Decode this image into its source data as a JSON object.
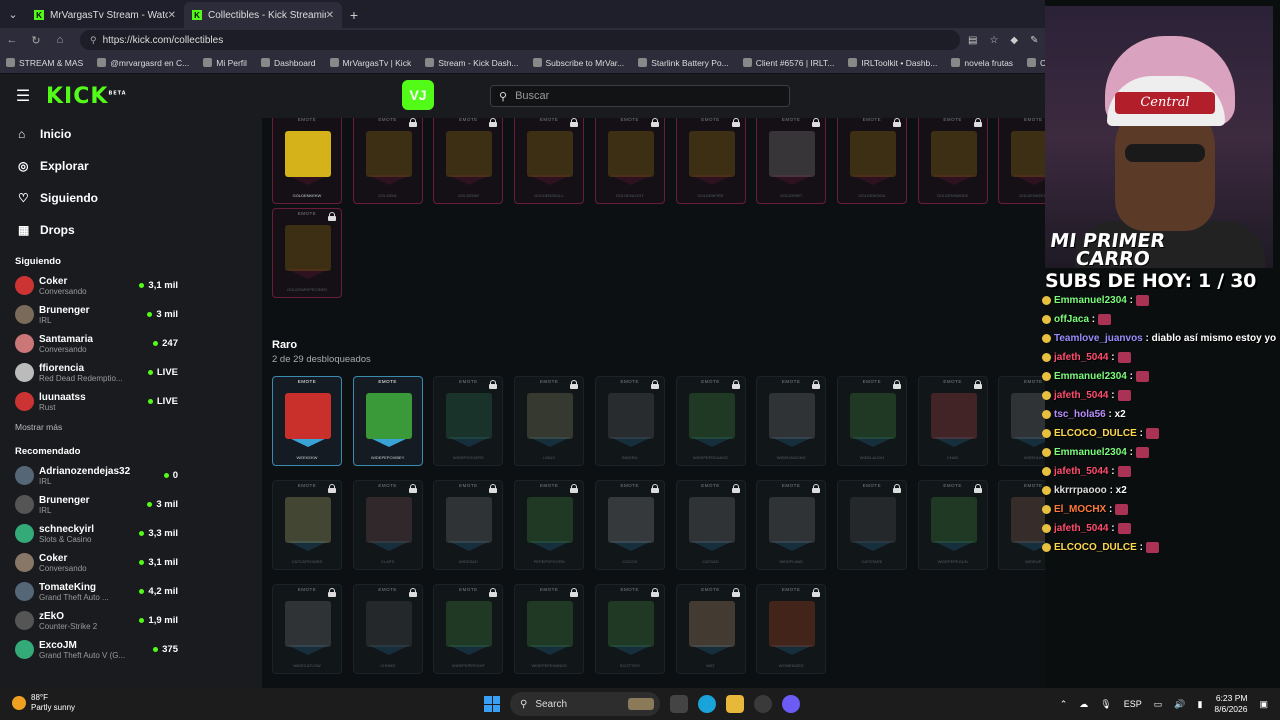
{
  "browser": {
    "tabs": [
      {
        "title": "MrVargasTv Stream - Watch Live o",
        "active": false
      },
      {
        "title": "Collectibles - Kick Streaming",
        "active": true
      }
    ],
    "url": "https://kick.com/collectibles",
    "bookmarks": [
      "STREAM & MAS",
      "@mrvargasrd en C...",
      "Mi Perfil",
      "Dashboard",
      "MrVargasTv | Kick",
      "Stream - Kick Dash...",
      "Subscribe to MrVar...",
      "Starlink Battery Po...",
      "Client #6576 | IRLT...",
      "IRLToolkit • Dashb...",
      "novela frutas",
      "Cu"
    ]
  },
  "header": {
    "logo": "KICK",
    "logo_sup": "BETA",
    "avatar_initials": "VJ",
    "search_placeholder": "Buscar"
  },
  "sidebar": {
    "nav": [
      {
        "label": "Inicio",
        "icon": "home-icon"
      },
      {
        "label": "Explorar",
        "icon": "compass-icon"
      },
      {
        "label": "Siguiendo",
        "icon": "heart-icon"
      },
      {
        "label": "Drops",
        "icon": "drops-icon"
      }
    ],
    "following_title": "Siguiendo",
    "following": [
      {
        "name": "Coker",
        "category": "Conversando",
        "viewers": "3,1 mil"
      },
      {
        "name": "Brunenger",
        "category": "IRL",
        "viewers": "3 mil"
      },
      {
        "name": "Santamaria",
        "category": "Conversando",
        "viewers": "247"
      },
      {
        "name": "ffiorencia",
        "category": "Red Dead Redemptio...",
        "viewers": "LIVE"
      },
      {
        "name": "luunaatss",
        "category": "Rust",
        "viewers": "LIVE"
      }
    ],
    "show_more": "Mostrar más",
    "recommended_title": "Recomendado",
    "recommended": [
      {
        "name": "Adrianozendejas32",
        "category": "IRL",
        "viewers": "0"
      },
      {
        "name": "Brunenger",
        "category": "IRL",
        "viewers": "3 mil"
      },
      {
        "name": "schneckyirl",
        "category": "Slots & Casino",
        "viewers": "3,3 mil"
      },
      {
        "name": "Coker",
        "category": "Conversando",
        "viewers": "3,1 mil"
      },
      {
        "name": "TomateKing",
        "category": "Grand Theft Auto ...",
        "viewers": "4,2 mil"
      },
      {
        "name": "zEkO",
        "category": "Counter-Strike 2",
        "viewers": "1,9 mil"
      },
      {
        "name": "ExcoJM",
        "category": "Grand Theft Auto V (G...",
        "viewers": "375"
      }
    ]
  },
  "main": {
    "emote_label": "EMOTE",
    "legendary_row": [
      {
        "name": "GOLDENKEKW",
        "unlocked": true,
        "color": "#d6b21a"
      },
      {
        "name": "GOLDENL",
        "unlocked": false,
        "color": "#8a6a10"
      },
      {
        "name": "GOLDENW",
        "unlocked": false,
        "color": "#8a6a10"
      },
      {
        "name": "GOLDENSKULL",
        "unlocked": false,
        "color": "#8a6a10"
      },
      {
        "name": "GOLDENLOOT",
        "unlocked": false,
        "color": "#8a6a10"
      },
      {
        "name": "GOLDENFIRE",
        "unlocked": false,
        "color": "#8a6a10"
      },
      {
        "name": "GOLDENRT",
        "unlocked": false,
        "color": "#7a7a7a"
      },
      {
        "name": "GOLDENGIGA",
        "unlocked": false,
        "color": "#8a6a10"
      },
      {
        "name": "GOLDENSMOKE",
        "unlocked": false,
        "color": "#8a6a10"
      },
      {
        "name": "GOLDENKEKW",
        "unlocked": false,
        "color": "#8a6a10"
      }
    ],
    "legendary_row2": [
      {
        "name": "GOLDENPEPECRIED",
        "unlocked": false,
        "color": "#8a6a10"
      }
    ],
    "rare_title": "Raro",
    "rare_subtitle": "2 de 29 desbloqueados",
    "rare_row1": [
      {
        "name": "WEEKEKW",
        "unlocked": true,
        "color": "#c9302c"
      },
      {
        "name": "WIDEPEPOVIBEY",
        "unlocked": true,
        "color": "#3a9a3a"
      },
      {
        "name": "WIDEPOGGERS",
        "unlocked": false,
        "color": "#2a6a4a"
      },
      {
        "name": "LINUX",
        "unlocked": false,
        "color": "#7a7a5a"
      },
      {
        "name": "BINGRU",
        "unlocked": false,
        "color": "#555"
      },
      {
        "name": "WIDEPEPEDANCE",
        "unlocked": false,
        "color": "#3a7a3a"
      },
      {
        "name": "WIDEDANCING",
        "unlocked": false,
        "color": "#6a6a6a"
      },
      {
        "name": "WIDELAUGH",
        "unlocked": false,
        "color": "#3a7a3a"
      },
      {
        "name": "CHAD",
        "unlocked": false,
        "color": "#a04040"
      },
      {
        "name": "WIDEHUH",
        "unlocked": false,
        "color": "#6a6a6a"
      }
    ],
    "rare_row2": [
      {
        "name": "CATCATROWER",
        "unlocked": false,
        "color": "#a0a060"
      },
      {
        "name": "CLAPS",
        "unlocked": false,
        "color": "#6a4a4a"
      },
      {
        "name": "WIDESAD",
        "unlocked": false,
        "color": "#6a6a6a"
      },
      {
        "name": "PEPEPOPCORN",
        "unlocked": false,
        "color": "#3a7a3a"
      },
      {
        "name": "COCOS",
        "unlocked": false,
        "color": "#7a7a7a"
      },
      {
        "name": "CATSAD",
        "unlocked": false,
        "color": "#6a6a6a"
      },
      {
        "name": "WIDEPLANE",
        "unlocked": false,
        "color": "#6a6a6a"
      },
      {
        "name": "CATSTARE",
        "unlocked": false,
        "color": "#4a4a4a"
      },
      {
        "name": "WIDEPEPEGUN",
        "unlocked": false,
        "color": "#3a7a3a"
      },
      {
        "name": "WIDEUP",
        "unlocked": false,
        "color": "#7a5a4a"
      }
    ],
    "rare_row3": [
      {
        "name": "WIDECATLOW",
        "unlocked": false,
        "color": "#6a6a6a"
      },
      {
        "name": "CHOMS",
        "unlocked": false,
        "color": "#4a4a4a"
      },
      {
        "name": "WIDEPEPEFIGHT",
        "unlocked": false,
        "color": "#3a7a3a"
      },
      {
        "name": "WIDEPEPEHANDS",
        "unlocked": false,
        "color": "#3a7a3a"
      },
      {
        "name": "SCOTTIES",
        "unlocked": false,
        "color": "#3a7a3a"
      },
      {
        "name": "WAT",
        "unlocked": false,
        "color": "#a08060"
      },
      {
        "name": "WOMENIZED",
        "unlocked": false,
        "color": "#a04020"
      }
    ]
  },
  "overlay": {
    "cap_text": "Central",
    "banner_line1": "MI PRIMER",
    "banner_line2": "CARRO",
    "subs": "SUBS DE HOY: 1 / 30",
    "chat": [
      {
        "user": "Emmanuel2304",
        "color": "#7cfc7c",
        "text": ":",
        "emote": true
      },
      {
        "user": "offJaca",
        "color": "#7cfc7c",
        "text": ":",
        "emote": true
      },
      {
        "user": "Teamlove_juanvos",
        "color": "#9b8cff",
        "text": ": diablo así mismo estoy yo",
        "emote": false
      },
      {
        "user": "jafeth_5044",
        "color": "#ff4d6d",
        "text": ":",
        "emote": true
      },
      {
        "user": "Emmanuel2304",
        "color": "#7cfc7c",
        "text": ":",
        "emote": true
      },
      {
        "user": "jafeth_5044",
        "color": "#ff4d6d",
        "text": ":",
        "emote": true
      },
      {
        "user": "tsc_hola56",
        "color": "#b88cff",
        "text": ": x2",
        "emote": false
      },
      {
        "user": "ELCOCO_DULCE",
        "color": "#ffd84d",
        "text": ":",
        "emote": true
      },
      {
        "user": "Emmanuel2304",
        "color": "#7cfc7c",
        "text": ":",
        "emote": true
      },
      {
        "user": "jafeth_5044",
        "color": "#ff4d6d",
        "text": ":",
        "emote": true
      },
      {
        "user": "kkrrrpaooo",
        "color": "#dddddd",
        "text": ": x2",
        "emote": false
      },
      {
        "user": "El_MOCHX",
        "color": "#ff7a3a",
        "text": ":",
        "emote": true
      },
      {
        "user": "jafeth_5044",
        "color": "#ff4d6d",
        "text": ":",
        "emote": true
      },
      {
        "user": "ELCOCO_DULCE",
        "color": "#ffd84d",
        "text": ":",
        "emote": true
      }
    ]
  },
  "taskbar": {
    "temp": "88°F",
    "weather": "Partly sunny",
    "search": "Search",
    "lang": "ESP",
    "time": "6:23 PM",
    "date": "8/6/2026"
  }
}
